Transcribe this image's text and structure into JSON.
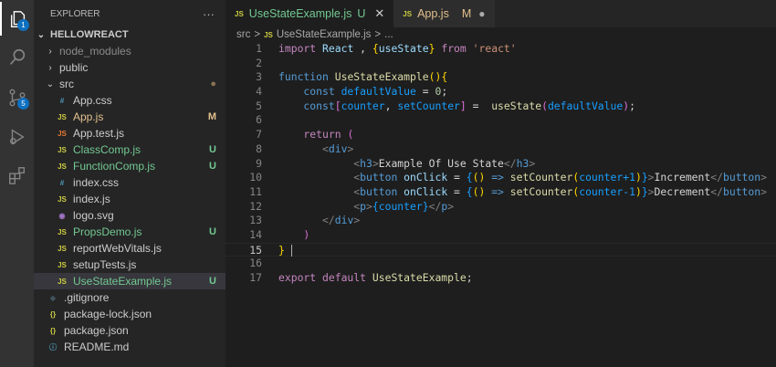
{
  "activity": {
    "explorer_badge": "1",
    "scm_badge": "5"
  },
  "sidebar": {
    "title": "EXPLORER",
    "more": "···",
    "project": "HELLOWREACT",
    "items": [
      {
        "label": "node_modules",
        "type": "folder",
        "open": false,
        "depth": 1,
        "color": "#8b8b8b"
      },
      {
        "label": "public",
        "type": "folder",
        "open": false,
        "depth": 1,
        "color": "#cccccc"
      },
      {
        "label": "src",
        "type": "folder",
        "open": true,
        "depth": 1,
        "color": "#cccccc",
        "status": "●",
        "status_color": "#8b7355"
      },
      {
        "label": "App.css",
        "icon": "#",
        "icon_color": "#519aba",
        "depth": 2,
        "color": "#cccccc"
      },
      {
        "label": "App.js",
        "icon": "JS",
        "icon_color": "#cbcb41",
        "depth": 2,
        "color": "#e2c08d",
        "status": "M",
        "status_color": "#e2c08d"
      },
      {
        "label": "App.test.js",
        "icon": "JS",
        "icon_color": "#e37933",
        "depth": 2,
        "color": "#cccccc"
      },
      {
        "label": "ClassComp.js",
        "icon": "JS",
        "icon_color": "#cbcb41",
        "depth": 2,
        "color": "#73c991",
        "status": "U",
        "status_color": "#73c991"
      },
      {
        "label": "FunctionComp.js",
        "icon": "JS",
        "icon_color": "#cbcb41",
        "depth": 2,
        "color": "#73c991",
        "status": "U",
        "status_color": "#73c991"
      },
      {
        "label": "index.css",
        "icon": "#",
        "icon_color": "#519aba",
        "depth": 2,
        "color": "#cccccc"
      },
      {
        "label": "index.js",
        "icon": "JS",
        "icon_color": "#cbcb41",
        "depth": 2,
        "color": "#cccccc"
      },
      {
        "label": "logo.svg",
        "icon": "◉",
        "icon_color": "#a074c4",
        "depth": 2,
        "color": "#cccccc"
      },
      {
        "label": "PropsDemo.js",
        "icon": "JS",
        "icon_color": "#cbcb41",
        "depth": 2,
        "color": "#73c991",
        "status": "U",
        "status_color": "#73c991"
      },
      {
        "label": "reportWebVitals.js",
        "icon": "JS",
        "icon_color": "#cbcb41",
        "depth": 2,
        "color": "#cccccc"
      },
      {
        "label": "setupTests.js",
        "icon": "JS",
        "icon_color": "#cbcb41",
        "depth": 2,
        "color": "#cccccc"
      },
      {
        "label": "UseStateExample.js",
        "icon": "JS",
        "icon_color": "#cbcb41",
        "depth": 2,
        "color": "#73c991",
        "status": "U",
        "status_color": "#73c991",
        "selected": true
      },
      {
        "label": ".gitignore",
        "icon": "◆",
        "icon_color": "#41535b",
        "depth": 1,
        "color": "#cccccc"
      },
      {
        "label": "package-lock.json",
        "icon": "{}",
        "icon_color": "#cbcb41",
        "depth": 1,
        "color": "#cccccc"
      },
      {
        "label": "package.json",
        "icon": "{}",
        "icon_color": "#cbcb41",
        "depth": 1,
        "color": "#cccccc"
      },
      {
        "label": "README.md",
        "icon": "ⓘ",
        "icon_color": "#519aba",
        "depth": 1,
        "color": "#cccccc"
      }
    ]
  },
  "tabs": [
    {
      "label": "UseStateExample.js",
      "status": "U",
      "icon": "JS",
      "close": "✕"
    },
    {
      "label": "App.js",
      "status": "M",
      "icon": "JS",
      "close": "●"
    }
  ],
  "breadcrumb": {
    "folder": "src",
    "sep": ">",
    "file": "UseStateExample.js",
    "icon": "JS",
    "more": "..."
  },
  "code": {
    "current_line": 15,
    "lines": [
      [
        [
          "import",
          "k"
        ],
        [
          " React ",
          "v"
        ],
        [
          ", ",
          "w"
        ],
        [
          "{",
          "y"
        ],
        [
          "useState",
          "v"
        ],
        [
          "}",
          "y"
        ],
        [
          " from ",
          "k"
        ],
        [
          "'react'",
          "s"
        ]
      ],
      [],
      [
        [
          "function ",
          "b"
        ],
        [
          "UseStateExample",
          "f"
        ],
        [
          "()",
          "y"
        ],
        [
          "{",
          "y"
        ]
      ],
      [
        [
          "    const ",
          "b"
        ],
        [
          "defaultValue",
          "c"
        ],
        [
          " = ",
          "w"
        ],
        [
          "0",
          "n"
        ],
        [
          ";",
          "w"
        ]
      ],
      [
        [
          "    const",
          "b"
        ],
        [
          "[",
          "p"
        ],
        [
          "counter",
          "c"
        ],
        [
          ", ",
          "w"
        ],
        [
          "setCounter",
          "c"
        ],
        [
          "]",
          "p"
        ],
        [
          " =  ",
          "w"
        ],
        [
          "useState",
          "f"
        ],
        [
          "(",
          "p"
        ],
        [
          "defaultValue",
          "c"
        ],
        [
          ")",
          "p"
        ],
        [
          ";",
          "w"
        ]
      ],
      [],
      [
        [
          "    return ",
          "k"
        ],
        [
          "(",
          "p"
        ]
      ],
      [
        [
          "       ",
          "w"
        ],
        [
          "<",
          "g"
        ],
        [
          "div",
          "b"
        ],
        [
          ">",
          "g"
        ]
      ],
      [
        [
          "            ",
          "w"
        ],
        [
          "<",
          "g"
        ],
        [
          "h3",
          "b"
        ],
        [
          ">",
          "g"
        ],
        [
          "Example Of Use State",
          "w"
        ],
        [
          "</",
          "g"
        ],
        [
          "h3",
          "b"
        ],
        [
          ">",
          "g"
        ]
      ],
      [
        [
          "            ",
          "w"
        ],
        [
          "<",
          "g"
        ],
        [
          "button ",
          "b"
        ],
        [
          "onClick",
          "v"
        ],
        [
          " = ",
          "w"
        ],
        [
          "{",
          "c"
        ],
        [
          "() ",
          "y"
        ],
        [
          "=> ",
          "b"
        ],
        [
          "setCounter",
          "f"
        ],
        [
          "(",
          "y"
        ],
        [
          "counter+1",
          "c"
        ],
        [
          ")",
          "y"
        ],
        [
          "}",
          "c"
        ],
        [
          ">",
          "g"
        ],
        [
          "Increment",
          "w"
        ],
        [
          "</",
          "g"
        ],
        [
          "button",
          "b"
        ],
        [
          ">",
          "g"
        ]
      ],
      [
        [
          "            ",
          "w"
        ],
        [
          "<",
          "g"
        ],
        [
          "button ",
          "b"
        ],
        [
          "onClick",
          "v"
        ],
        [
          " = ",
          "w"
        ],
        [
          "{",
          "c"
        ],
        [
          "() ",
          "y"
        ],
        [
          "=> ",
          "b"
        ],
        [
          "setCounter",
          "f"
        ],
        [
          "(",
          "y"
        ],
        [
          "counter-1",
          "c"
        ],
        [
          ")",
          "y"
        ],
        [
          "}",
          "c"
        ],
        [
          ">",
          "g"
        ],
        [
          "Decrement",
          "w"
        ],
        [
          "</",
          "g"
        ],
        [
          "button",
          "b"
        ],
        [
          ">",
          "g"
        ]
      ],
      [
        [
          "            ",
          "w"
        ],
        [
          "<",
          "g"
        ],
        [
          "p",
          "b"
        ],
        [
          ">",
          "g"
        ],
        [
          "{",
          "c"
        ],
        [
          "counter",
          "c"
        ],
        [
          "}",
          "c"
        ],
        [
          "</",
          "g"
        ],
        [
          "p",
          "b"
        ],
        [
          ">",
          "g"
        ]
      ],
      [
        [
          "       ",
          "w"
        ],
        [
          "</",
          "g"
        ],
        [
          "div",
          "b"
        ],
        [
          ">",
          "g"
        ]
      ],
      [
        [
          "    )",
          "p"
        ]
      ],
      [
        [
          "}",
          "y"
        ],
        [
          " ",
          "w"
        ]
      ],
      [],
      [
        [
          "export default ",
          "k"
        ],
        [
          "UseStateExample",
          "f"
        ],
        [
          ";",
          "w"
        ]
      ]
    ]
  }
}
